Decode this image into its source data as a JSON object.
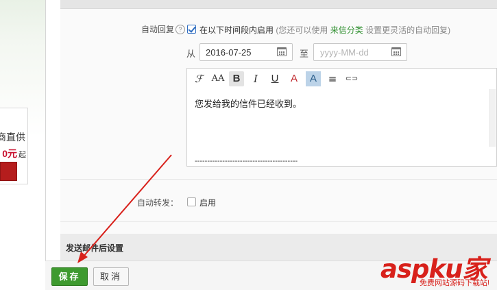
{
  "sidebar_ad": {
    "line1": "商直供",
    "price": "0元",
    "unit": "起"
  },
  "auto_reply": {
    "label": "自动回复",
    "help_icon": "?",
    "enabled": true,
    "enable_text": "在以下时间段内启用",
    "hint_prefix": "(您还可以使用",
    "hint_link": "来信分类",
    "hint_suffix": "设置更灵活的自动回复)",
    "from_label": "从",
    "from_value": "2016-07-25",
    "to_label": "至",
    "to_placeholder": "yyyy-MM-dd",
    "body_text": "您发给我的信件已经收到。",
    "signature_separator": "-----------------------------------------"
  },
  "toolbar": {
    "font": "ℱ",
    "font_size": "AA",
    "bold": "B",
    "italic": "I",
    "underline": "U",
    "text_color": "A",
    "bg_color": "A",
    "align": "≡",
    "link": "⊂⊃"
  },
  "auto_forward": {
    "label": "自动转发：",
    "enabled": false,
    "enable_text": "启用"
  },
  "send_settings": {
    "title": "发送邮件后设置"
  },
  "buttons": {
    "save": "保存",
    "cancel": "取消"
  },
  "watermark": {
    "main": "aspku.com",
    "main_display": "aspku家",
    "sub": "免费网站源码下载站!"
  },
  "colors": {
    "save_green": "#3e9a2f",
    "link_green": "#2f8f2f",
    "arrow_red": "#d8211b",
    "ad_red": "#b51d1d"
  }
}
